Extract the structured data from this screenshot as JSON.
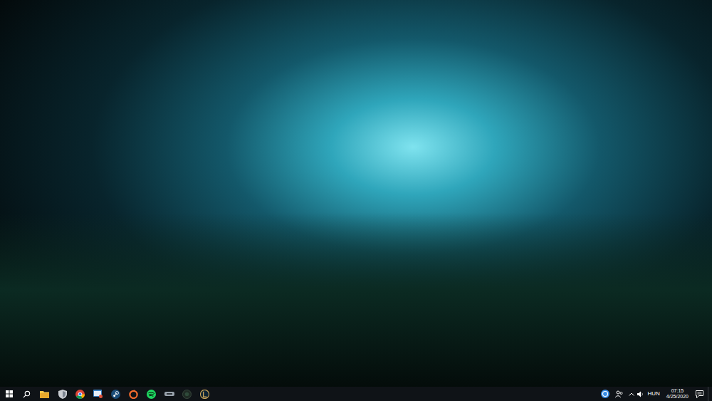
{
  "taskbar": {
    "language": "HUN",
    "time": "07:15",
    "date": "4/25/2020"
  }
}
